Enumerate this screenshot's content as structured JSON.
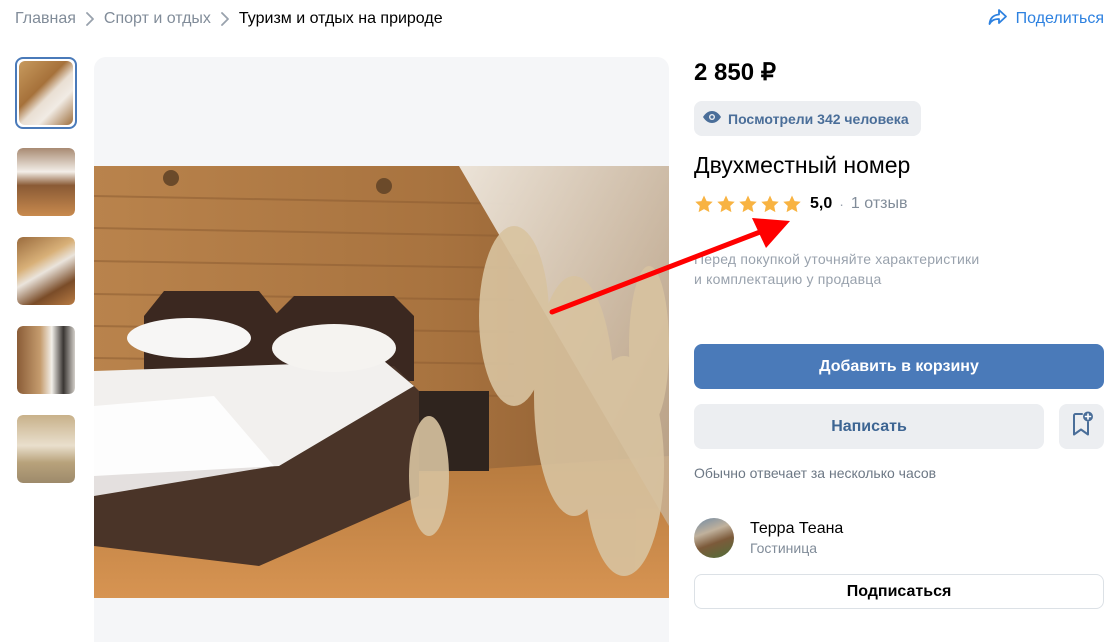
{
  "breadcrumb": {
    "items": [
      {
        "label": "Главная"
      },
      {
        "label": "Спорт и отдых"
      }
    ],
    "current": "Туризм и отдых на природе"
  },
  "share": {
    "label": "Поделиться",
    "icon": "share-icon"
  },
  "thumbnails": [
    {
      "name": "thumbnail-1",
      "active": true
    },
    {
      "name": "thumbnail-2",
      "active": false
    },
    {
      "name": "thumbnail-3",
      "active": false
    },
    {
      "name": "thumbnail-4",
      "active": false
    },
    {
      "name": "thumbnail-5",
      "active": false
    }
  ],
  "product": {
    "price": "2 850 ₽",
    "views": "Посмотрели 342 человека",
    "title": "Двухместный номер",
    "rating": "5,0",
    "stars": 5,
    "rating_separator": "·",
    "reviews": "1 отзыв",
    "note_line1": "Перед покупкой уточняйте характеристики",
    "note_line2": "и комплектацию у продавца"
  },
  "actions": {
    "add_to_cart": "Добавить в корзину",
    "write": "Написать",
    "reply_time": "Обычно отвечает за несколько часов",
    "subscribe": "Подписаться"
  },
  "seller": {
    "name": "Терра Теана",
    "type": "Гостиница"
  },
  "colors": {
    "accent": "#4a7ab9",
    "link": "#2d81e0",
    "star": "#f8b342",
    "annotation_arrow": "#ff0000"
  }
}
